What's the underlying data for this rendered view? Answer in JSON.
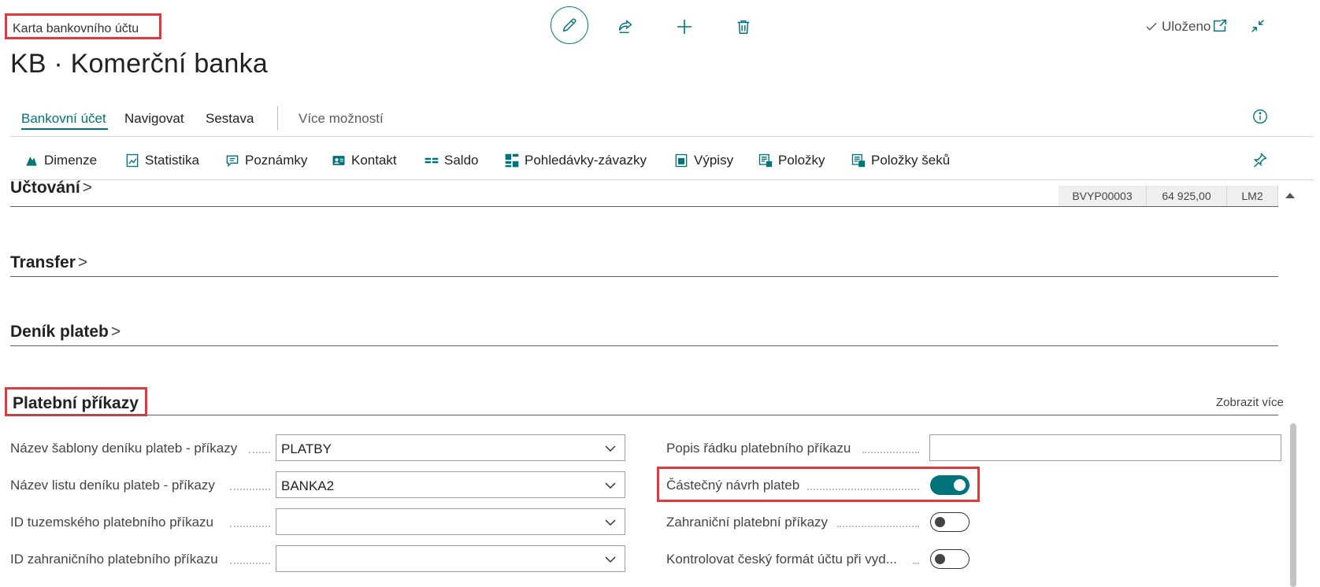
{
  "header": {
    "breadcrumb": "Karta bankovního účtu",
    "title": "KB · Komerční banka",
    "saved_label": "Uloženo"
  },
  "icons": {
    "edit": "pencil-icon",
    "share": "share-icon",
    "new": "plus-icon",
    "delete": "trash-icon",
    "saved": "checkmark-icon",
    "open_new_window": "open-in-new-window-icon",
    "collapse": "collapse-icon",
    "info": "info-icon",
    "pin": "pin-icon"
  },
  "tabs": {
    "items": [
      "Bankovní účet",
      "Navigovat",
      "Sestava"
    ],
    "more": "Více možností"
  },
  "actions": [
    {
      "label": "Dimenze",
      "icon": "dimensions-icon"
    },
    {
      "label": "Statistika",
      "icon": "statistics-icon"
    },
    {
      "label": "Poznámky",
      "icon": "notes-icon"
    },
    {
      "label": "Kontakt",
      "icon": "contact-icon"
    },
    {
      "label": "Saldo",
      "icon": "balance-icon"
    },
    {
      "label": "Pohledávky-závazky",
      "icon": "receivables-icon"
    },
    {
      "label": "Výpisy",
      "icon": "statements-icon"
    },
    {
      "label": "Položky",
      "icon": "entries-icon"
    },
    {
      "label": "Položky šeků",
      "icon": "check-entries-icon"
    }
  ],
  "mini_table": [
    "BVYP00003",
    "64 925,00",
    "LM2"
  ],
  "sections": {
    "posting": "Účtování",
    "transfer": "Transfer",
    "payment_journal": "Deník plateb",
    "payment_orders": "Platební příkazy",
    "show_more": "Zobrazit více"
  },
  "fields_left": [
    {
      "label": "Název šablony deníku plateb - příkazy",
      "value": "PLATBY"
    },
    {
      "label": "Název listu deníku plateb - příkazy",
      "value": "BANKA2"
    },
    {
      "label": "ID tuzemského platebního příkazu",
      "value": ""
    },
    {
      "label": "ID zahraničního platebního příkazu",
      "value": ""
    }
  ],
  "fields_right": [
    {
      "label": "Popis řádku platebního příkazu",
      "type": "text",
      "value": ""
    },
    {
      "label": "Částečný návrh plateb",
      "type": "toggle",
      "value": true
    },
    {
      "label": "Zahraniční platební příkazy",
      "type": "toggle",
      "value": false
    },
    {
      "label": "Kontrolovat český formát účtu při vyd...",
      "type": "toggle",
      "value": false
    }
  ],
  "colors": {
    "accent": "#00747a",
    "highlight": "#e0393e"
  }
}
